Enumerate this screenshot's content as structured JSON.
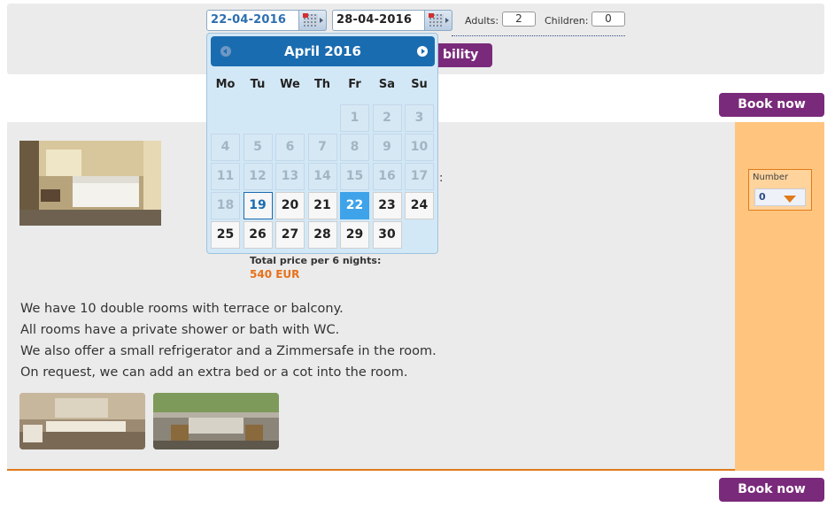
{
  "search": {
    "checkin": "22-04-2016",
    "checkout": "28-04-2016",
    "adults_label": "Adults:",
    "adults_value": "2",
    "children_label": "Children:",
    "children_value": "0",
    "check_button_visible": "bility"
  },
  "book_now_label": "Book now",
  "room": {
    "total_label": "Total price per 6 nights:",
    "total_price": "540 EUR",
    "colon": ":",
    "description": [
      "We have 10 double rooms with terrace or balcony.",
      "All rooms have a private shower or bath with WC.",
      "We also offer a small refrigerator and a Zimmersafe in the room.",
      "On request, we can add an extra bed or a cot into the room."
    ],
    "number_label": "Number",
    "number_value": "0"
  },
  "datepicker": {
    "title": "April 2016",
    "weekdays": [
      "Mo",
      "Tu",
      "We",
      "Th",
      "Fr",
      "Sa",
      "Su"
    ],
    "first_weekday_index": 4,
    "days_in_month": 30,
    "disabled_before": 19,
    "today": 19,
    "selected": 22
  },
  "colors": {
    "purple": "#7a2a7a",
    "orange": "#e8711a",
    "calendar_header": "#1a6cb0",
    "selected_day": "#3fa3ea"
  }
}
